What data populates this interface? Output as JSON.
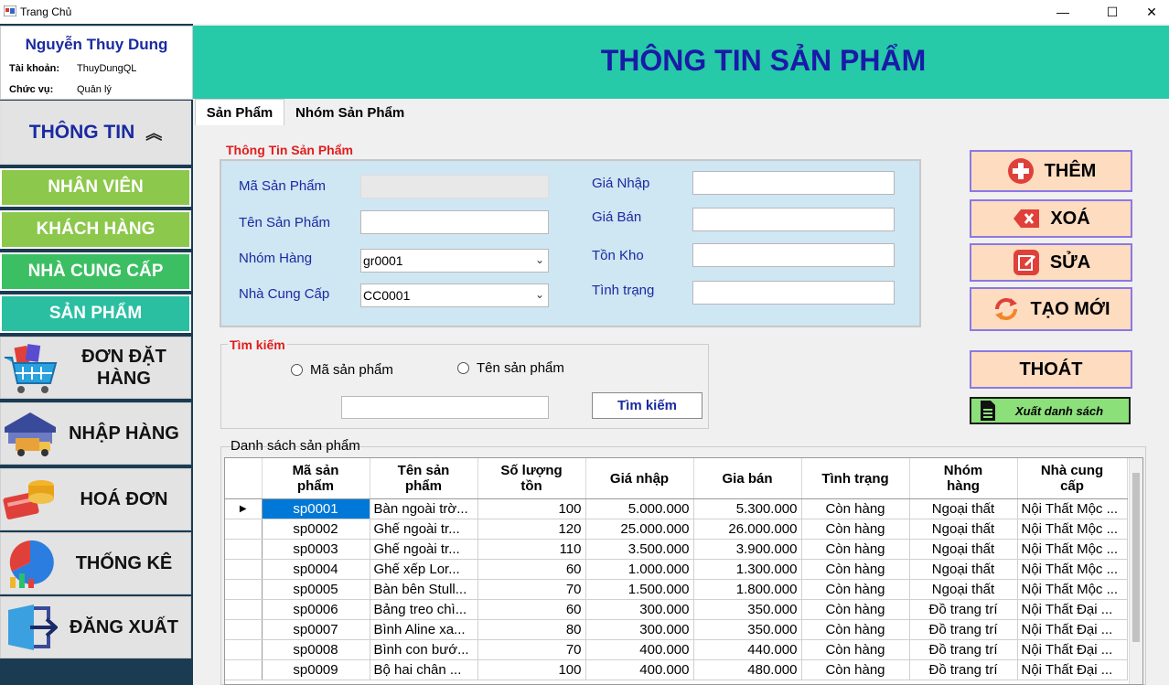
{
  "window": {
    "title": "Trang Chủ",
    "minimize": "—",
    "maximize": "☐",
    "close": "✕"
  },
  "profile": {
    "name": "Nguyễn Thuy Dung",
    "account_label": "Tài khoản:",
    "account_value": "ThuyDungQL",
    "role_label": "Chức vụ:",
    "role_value": "Quản lý"
  },
  "sidebar": {
    "thongtin": "THÔNG TIN",
    "thongtin_chevron": "︽",
    "nhanvien": "NHÂN VIÊN",
    "khachhang": "KHÁCH HÀNG",
    "nhacungcap": "NHÀ CUNG CẤP",
    "sanpham": "SẢN PHẨM",
    "dondathang_1": "ĐƠN ĐẶT",
    "dondathang_2": "HÀNG",
    "nhaphang": "NHẬP HÀNG",
    "hoadon": "HOÁ ĐƠN",
    "thongke": "THỐNG KÊ",
    "dangxuat": "ĐĂNG XUẤT"
  },
  "header": {
    "title": "THÔNG TIN SẢN PHẨM"
  },
  "tabs": {
    "sanpham": "Sản Phẩm",
    "nhomsanpham": "Nhóm Sản Phẩm"
  },
  "info": {
    "group_title": "Thông Tin Sản Phẩm",
    "ma_label": "Mã Sản Phẩm",
    "ma_value": "",
    "ten_label": "Tên Sản Phẩm",
    "ten_value": "",
    "nhom_label": "Nhóm Hàng",
    "nhom_value": "gr0001",
    "ncc_label": "Nhà Cung Cấp",
    "ncc_value": "CC0001",
    "gianhap_label": "Giá Nhập",
    "gianhap_value": "",
    "giaban_label": "Giá Bán",
    "giaban_value": "",
    "tonkho_label": "Tồn Kho",
    "tonkho_value": "",
    "tinhtrang_label": "Tình trạng",
    "tinhtrang_value": ""
  },
  "search": {
    "group_title": "Tìm kiếm",
    "radio_ma": "Mã sản phẩm",
    "radio_ten": "Tên sản phẩm",
    "query": "",
    "button": "Tìm kiếm"
  },
  "actions": {
    "them": "THÊM",
    "xoa": "XOÁ",
    "sua": "SỬA",
    "taomoi": "TẠO MỚI",
    "thoat": "THOÁT",
    "export": "Xuất danh sách"
  },
  "list": {
    "title": "Danh sách sản phẩm",
    "columns": [
      [
        "Mã sản",
        "phẩm"
      ],
      [
        "Tên sản",
        "phẩm"
      ],
      [
        "Số lượng",
        "tồn"
      ],
      [
        "Giá nhập",
        ""
      ],
      [
        "Gia bán",
        ""
      ],
      [
        "Tình trạng",
        ""
      ],
      [
        "Nhóm",
        "hàng"
      ],
      [
        "Nhà cung",
        "cấp"
      ]
    ],
    "rows": [
      [
        "sp0001",
        "Bàn ngoài trờ...",
        "100",
        "5.000.000",
        "5.300.000",
        "Còn hàng",
        "Ngoại thất",
        "Nội Thất Mộc ..."
      ],
      [
        "sp0002",
        "Ghế ngoài tr...",
        "120",
        "25.000.000",
        "26.000.000",
        "Còn hàng",
        "Ngoại thất",
        "Nội Thất Mộc ..."
      ],
      [
        "sp0003",
        "Ghế ngoài tr...",
        "110",
        "3.500.000",
        "3.900.000",
        "Còn hàng",
        "Ngoại thất",
        "Nội Thất Mộc ..."
      ],
      [
        "sp0004",
        "Ghế xếp Lor...",
        "60",
        "1.000.000",
        "1.300.000",
        "Còn hàng",
        "Ngoại thất",
        "Nội Thất Mộc ..."
      ],
      [
        "sp0005",
        "Bàn bên Stull...",
        "70",
        "1.500.000",
        "1.800.000",
        "Còn hàng",
        "Ngoại thất",
        "Nội Thất Mộc ..."
      ],
      [
        "sp0006",
        "Bảng treo chì...",
        "60",
        "300.000",
        "350.000",
        "Còn hàng",
        "Đồ trang trí",
        "Nội Thất Đại ..."
      ],
      [
        "sp0007",
        "Bình Aline xa...",
        "80",
        "300.000",
        "350.000",
        "Còn hàng",
        "Đồ trang trí",
        "Nội Thất Đại ..."
      ],
      [
        "sp0008",
        "Bình con bướ...",
        "70",
        "400.000",
        "440.000",
        "Còn hàng",
        "Đồ trang trí",
        "Nội Thất Đại ..."
      ],
      [
        "sp0009",
        "Bộ hai chân ...",
        "100",
        "400.000",
        "480.000",
        "Còn hàng",
        "Đồ trang trí",
        "Nội Thất Đại ..."
      ]
    ]
  },
  "colors": {
    "header": "#26c9a8",
    "title_blue": "#1a1aa8",
    "sidebar_bg": "#1b3b52",
    "action_btn": "#fddcc0",
    "action_border": "#8a78e6"
  }
}
